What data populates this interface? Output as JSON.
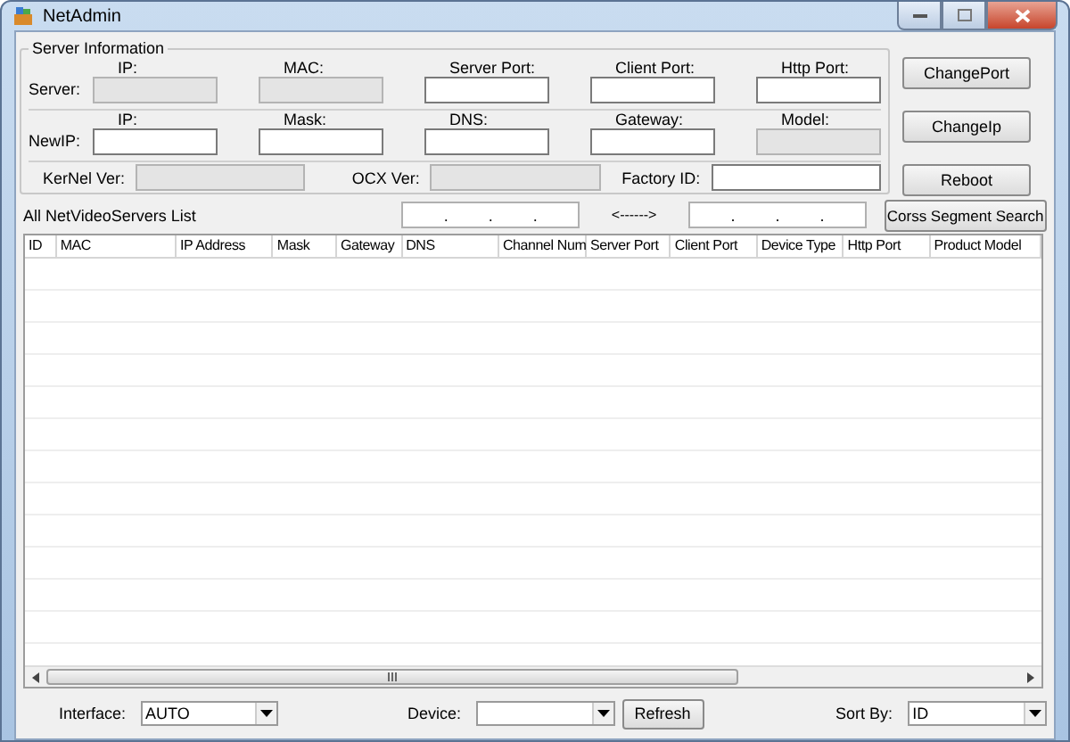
{
  "window": {
    "title": "NetAdmin"
  },
  "server_info": {
    "title": "Server Information",
    "server_row": {
      "label": "Server:",
      "fields": [
        {
          "label": "IP:",
          "readonly": true
        },
        {
          "label": "MAC:",
          "readonly": true
        },
        {
          "label": "Server Port:",
          "readonly": false
        },
        {
          "label": "Client Port:",
          "readonly": false
        },
        {
          "label": "Http Port:",
          "readonly": false
        }
      ]
    },
    "newip_row": {
      "label": "NewIP:",
      "fields": [
        {
          "label": "IP:",
          "readonly": false
        },
        {
          "label": "Mask:",
          "readonly": false
        },
        {
          "label": "DNS:",
          "readonly": false
        },
        {
          "label": "Gateway:",
          "readonly": false
        },
        {
          "label": "Model:",
          "readonly": true
        }
      ]
    },
    "versions": [
      {
        "label": "KerNel Ver:",
        "readonly": true
      },
      {
        "label": "OCX Ver:",
        "readonly": true
      },
      {
        "label": "Factory ID:",
        "readonly": false
      }
    ]
  },
  "side_buttons": [
    "ChangePort",
    "ChangeIp",
    "Reboot"
  ],
  "list": {
    "title": "All NetVideoServers List",
    "start_separators": [
      ".",
      ".",
      "."
    ],
    "arrow": "<------>",
    "end_separators": [
      ".",
      ".",
      "."
    ],
    "search_button": "Corss Segment Search"
  },
  "table": {
    "columns": [
      "ID",
      "MAC",
      "IP Address",
      "Mask",
      "Gateway",
      "DNS",
      "Channel Num",
      "Server Port",
      "Client Port",
      "Device Type",
      "Http Port",
      "Product Model"
    ]
  },
  "bottom": {
    "interface": {
      "label": "Interface:",
      "value": "AUTO"
    },
    "device": {
      "label": "Device:"
    },
    "refresh_button": "Refresh",
    "sort": {
      "label": "Sort By:",
      "value": "ID"
    }
  }
}
